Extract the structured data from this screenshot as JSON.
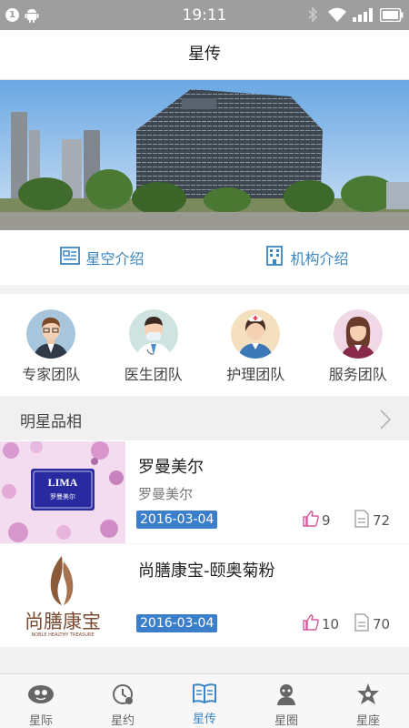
{
  "status_bar": {
    "notification_count": "1",
    "time": "19:11",
    "icons": [
      "notification-badge",
      "android-icon",
      "bluetooth-icon",
      "wifi-icon",
      "signal-icon",
      "battery-icon"
    ]
  },
  "header": {
    "title": "星传"
  },
  "intro": [
    {
      "label": "星空介绍",
      "icon": "newspaper-icon"
    },
    {
      "label": "机构介绍",
      "icon": "building-icon"
    }
  ],
  "teams": [
    {
      "label": "专家团队",
      "icon": "expert-avatar"
    },
    {
      "label": "医生团队",
      "icon": "doctor-avatar"
    },
    {
      "label": "护理团队",
      "icon": "nurse-avatar"
    },
    {
      "label": "服务团队",
      "icon": "service-avatar"
    }
  ],
  "section": {
    "title": "明星品相"
  },
  "items": [
    {
      "name": "罗曼美尔",
      "subtitle": "罗曼美尔",
      "date": "2016-03-04",
      "likes": "9",
      "comments": "72",
      "logo_text": "LIMA",
      "logo_sub": "罗曼美尔"
    },
    {
      "name": "尚膳康宝-颐奥菊粉",
      "subtitle": "",
      "date": "2016-03-04",
      "likes": "10",
      "comments": "70",
      "logo_text": "尚膳康宝",
      "logo_sub": "NOBLE HEALTHY TREASURE"
    }
  ],
  "tabs": [
    {
      "label": "星际",
      "icon": "planet-icon",
      "active": false
    },
    {
      "label": "星约",
      "icon": "clock-icon",
      "active": false
    },
    {
      "label": "星传",
      "icon": "book-icon",
      "active": true
    },
    {
      "label": "星圈",
      "icon": "people-icon",
      "active": false
    },
    {
      "label": "星座",
      "icon": "star-icon",
      "active": false
    }
  ],
  "colors": {
    "accent": "#3a86c4",
    "date_badge": "#3b7fcb",
    "status_bar": "#9e9e9e",
    "like_icon": "#d9579a"
  }
}
